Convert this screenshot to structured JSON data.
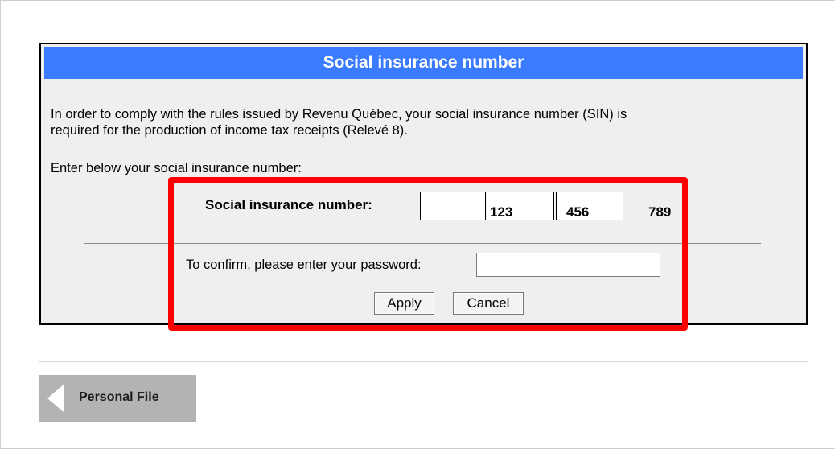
{
  "panel": {
    "title": "Social insurance number",
    "intro_line1": "In order to comply with the rules issued by Revenu Québec, your social insurance number (SIN) is",
    "intro_line2": "required for the production of income tax receipts (Relevé 8).",
    "enter_below": "Enter below your social insurance number:"
  },
  "sin": {
    "label": "Social insurance number:",
    "segments": [
      "",
      "123",
      "456"
    ],
    "trailing": "789"
  },
  "confirm": {
    "label": "To confirm, please enter your password:",
    "password_value": ""
  },
  "buttons": {
    "apply": "Apply",
    "cancel": "Cancel"
  },
  "nav": {
    "back_label": "Personal File",
    "back_icon": "left-arrow-icon"
  },
  "colors": {
    "header_bg": "#3a7bff",
    "highlight": "#ff0000",
    "panel_bg": "#efefef"
  }
}
